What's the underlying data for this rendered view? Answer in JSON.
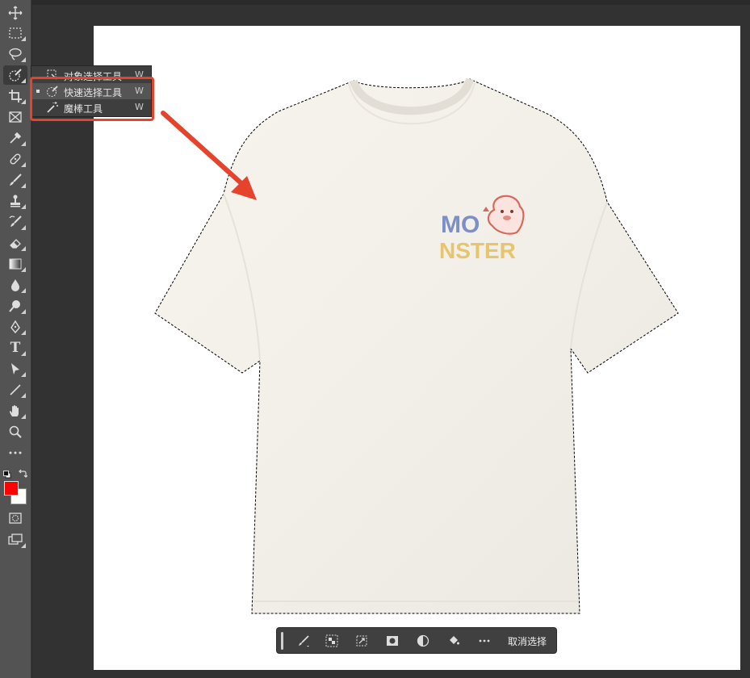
{
  "flyout_menu": {
    "items": [
      {
        "label": "对象选择工具",
        "shortcut": "W"
      },
      {
        "label": "快速选择工具",
        "shortcut": "W",
        "selected": true
      },
      {
        "label": "魔棒工具",
        "shortcut": "W"
      }
    ]
  },
  "print": {
    "line1": "MO",
    "line2": "NSTER"
  },
  "taskbar": {
    "deselect_label": "取消选择"
  },
  "toolbar": {
    "type_tool_glyph": "T",
    "foreground_color": "#ff0000",
    "background_color": "#ffffff"
  },
  "colors": {
    "highlight": "#e5432c",
    "arrow": "#e5432c"
  },
  "icons": [
    "move-icon",
    "marquee-icon",
    "lasso-icon",
    "quick-select-icon",
    "crop-icon",
    "frame-icon",
    "eyedropper-icon",
    "healing-brush-icon",
    "brush-icon",
    "clone-stamp-icon",
    "history-brush-icon",
    "eraser-icon",
    "gradient-icon",
    "blur-icon",
    "dodge-icon",
    "pen-icon",
    "type-icon",
    "path-select-icon",
    "line-icon",
    "hand-icon",
    "zoom-icon",
    "more-icon"
  ]
}
